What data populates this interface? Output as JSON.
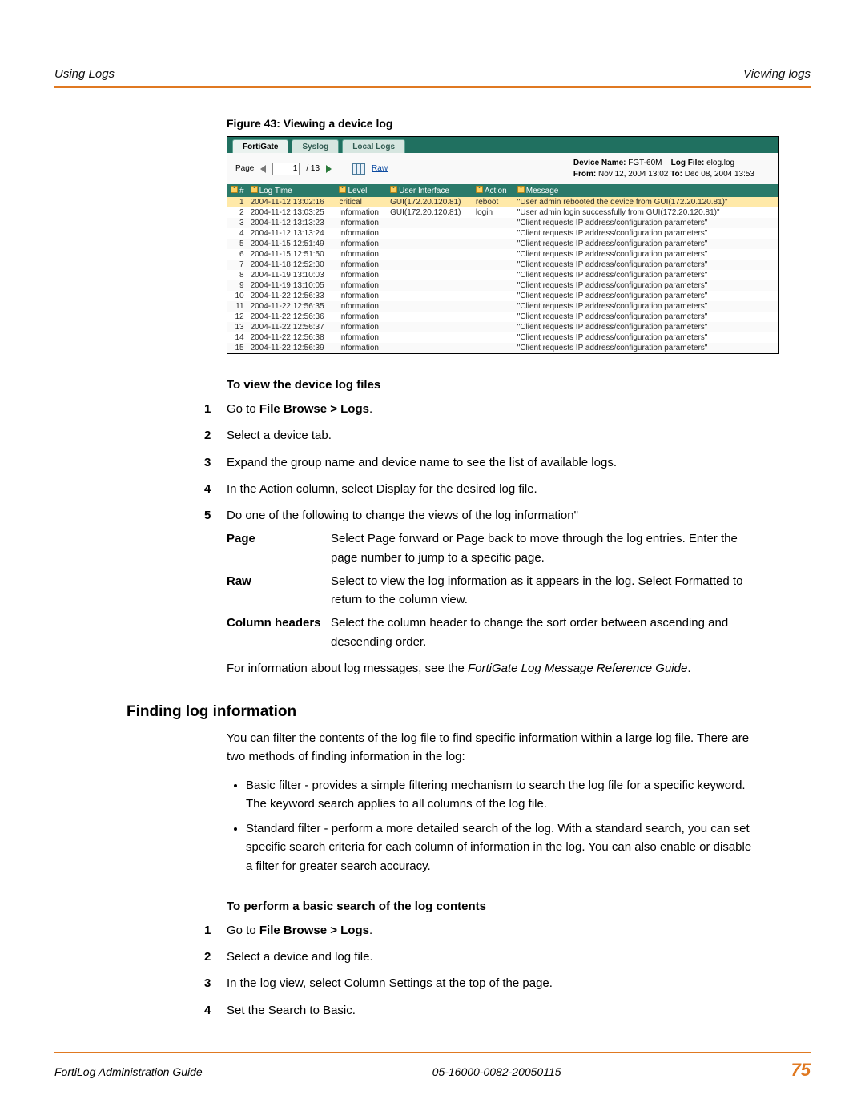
{
  "header": {
    "left": "Using Logs",
    "right": "Viewing logs"
  },
  "figure_caption": "Figure 43: Viewing a device log",
  "shot": {
    "tabs": [
      "FortiGate",
      "Syslog",
      "Local Logs"
    ],
    "active_tab": 0,
    "toolbar": {
      "page_label": "Page",
      "page_value": "1",
      "page_total": "/ 13",
      "raw_label": "Raw"
    },
    "meta": {
      "device_label": "Device Name:",
      "device_value": "FGT-60M",
      "logfile_label": "Log File:",
      "logfile_value": "elog.log",
      "from_label": "From:",
      "from_value": "Nov 12, 2004 13:02",
      "to_label": "To:",
      "to_value": "Dec 08, 2004 13:53"
    },
    "cols": [
      "#",
      "Log Time",
      "Level",
      "User Interface",
      "Action",
      "Message"
    ],
    "rows": [
      {
        "n": "1",
        "t": "2004-11-12 13:02:16",
        "lv": "critical",
        "ui": "GUI(172.20.120.81)",
        "a": "reboot",
        "m": "\"User admin rebooted the device from GUI(172.20.120.81)\"",
        "hi": true
      },
      {
        "n": "2",
        "t": "2004-11-12 13:03:25",
        "lv": "information",
        "ui": "GUI(172.20.120.81)",
        "a": "login",
        "m": "\"User admin login successfully from GUI(172.20.120.81)\""
      },
      {
        "n": "3",
        "t": "2004-11-12 13:13:23",
        "lv": "information",
        "ui": "",
        "a": "",
        "m": "\"Client requests IP address/configuration parameters\""
      },
      {
        "n": "4",
        "t": "2004-11-12 13:13:24",
        "lv": "information",
        "ui": "",
        "a": "",
        "m": "\"Client requests IP address/configuration parameters\""
      },
      {
        "n": "5",
        "t": "2004-11-15 12:51:49",
        "lv": "information",
        "ui": "",
        "a": "",
        "m": "\"Client requests IP address/configuration parameters\""
      },
      {
        "n": "6",
        "t": "2004-11-15 12:51:50",
        "lv": "information",
        "ui": "",
        "a": "",
        "m": "\"Client requests IP address/configuration parameters\""
      },
      {
        "n": "7",
        "t": "2004-11-18 12:52:30",
        "lv": "information",
        "ui": "",
        "a": "",
        "m": "\"Client requests IP address/configuration parameters\""
      },
      {
        "n": "8",
        "t": "2004-11-19 13:10:03",
        "lv": "information",
        "ui": "",
        "a": "",
        "m": "\"Client requests IP address/configuration parameters\""
      },
      {
        "n": "9",
        "t": "2004-11-19 13:10:05",
        "lv": "information",
        "ui": "",
        "a": "",
        "m": "\"Client requests IP address/configuration parameters\""
      },
      {
        "n": "10",
        "t": "2004-11-22 12:56:33",
        "lv": "information",
        "ui": "",
        "a": "",
        "m": "\"Client requests IP address/configuration parameters\""
      },
      {
        "n": "11",
        "t": "2004-11-22 12:56:35",
        "lv": "information",
        "ui": "",
        "a": "",
        "m": "\"Client requests IP address/configuration parameters\""
      },
      {
        "n": "12",
        "t": "2004-11-22 12:56:36",
        "lv": "information",
        "ui": "",
        "a": "",
        "m": "\"Client requests IP address/configuration parameters\""
      },
      {
        "n": "13",
        "t": "2004-11-22 12:56:37",
        "lv": "information",
        "ui": "",
        "a": "",
        "m": "\"Client requests IP address/configuration parameters\""
      },
      {
        "n": "14",
        "t": "2004-11-22 12:56:38",
        "lv": "information",
        "ui": "",
        "a": "",
        "m": "\"Client requests IP address/configuration parameters\""
      },
      {
        "n": "15",
        "t": "2004-11-22 12:56:39",
        "lv": "information",
        "ui": "",
        "a": "",
        "m": "\"Client requests IP address/configuration parameters\""
      }
    ]
  },
  "proc1": {
    "title": "To view the device log files",
    "steps": [
      {
        "pre": "Go to ",
        "bold": "File Browse > Logs",
        "post": "."
      },
      {
        "text": "Select a device tab."
      },
      {
        "text": "Expand the group name and device name to see the list of available logs."
      },
      {
        "text": "In the Action column, select Display for the desired log file."
      },
      {
        "text": "Do one of the following to change the views of the log information\""
      }
    ],
    "defs": [
      {
        "term": "Page",
        "desc": "Select Page forward or Page back to move through the log entries. Enter the page number to jump to a specific page."
      },
      {
        "term": "Raw",
        "desc": "Select to view the log information as it appears in the log. Select Formatted to return to the column view."
      },
      {
        "term": "Column headers",
        "desc": "Select the column header to change the sort order between ascending and descending order."
      }
    ],
    "note_pre": "For information about log messages, see the ",
    "note_ital": "FortiGate Log Message Reference Guide",
    "note_post": "."
  },
  "section2": {
    "heading": "Finding log information",
    "p1": "You can filter the contents of the log file to find specific information within a large log file. There are two methods of finding information in the log:",
    "bullets": [
      "Basic filter - provides a simple filtering mechanism to search the log file for a specific keyword. The keyword search applies to all columns of the log file.",
      "Standard filter - perform a more detailed search of the log. With a standard search, you can set specific search criteria for each column of information in the log. You can also enable or disable a filter for greater search accuracy."
    ],
    "proc_title": "To perform a basic search of the log contents",
    "steps": [
      {
        "pre": "Go to ",
        "bold": "File Browse > Logs",
        "post": "."
      },
      {
        "text": "Select a device and log file."
      },
      {
        "text": "In the log view, select Column Settings at the top of the page."
      },
      {
        "text": "Set the Search to Basic."
      }
    ]
  },
  "footer": {
    "left": "FortiLog Administration Guide",
    "center": "05-16000-0082-20050115",
    "page": "75"
  }
}
